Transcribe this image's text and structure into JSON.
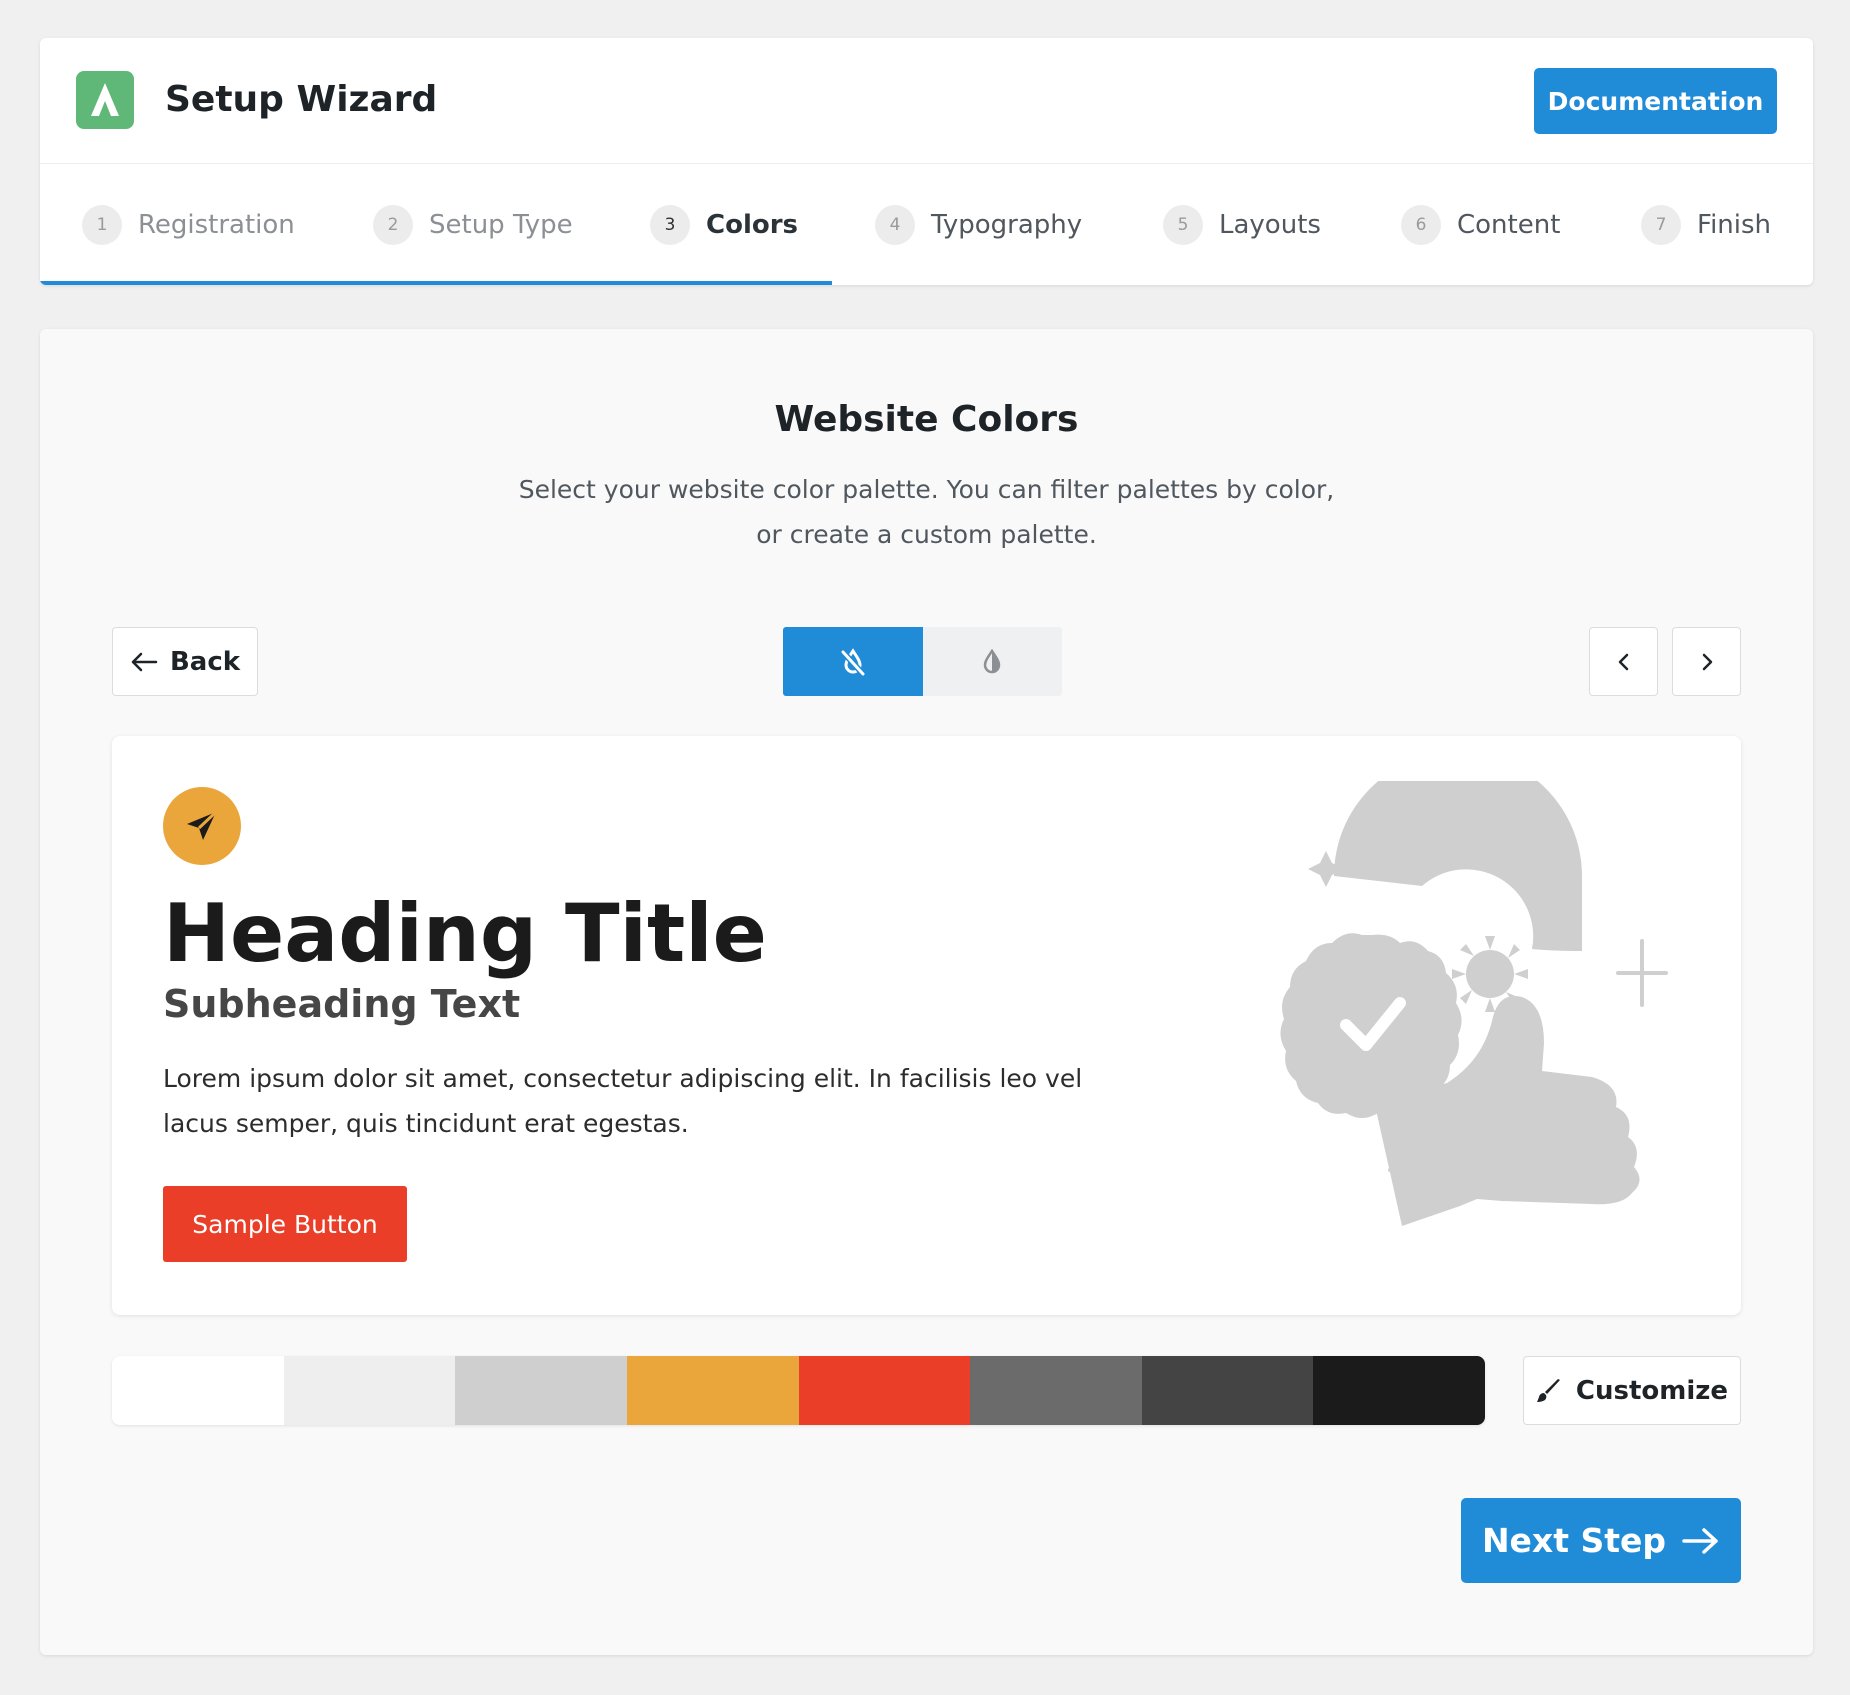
{
  "header": {
    "title": "Setup Wizard",
    "logo_icon": "wizard-logo-icon",
    "documentation_label": "Documentation"
  },
  "steps": [
    {
      "num": "1",
      "label": "Registration",
      "state": "done"
    },
    {
      "num": "2",
      "label": "Setup Type",
      "state": "done"
    },
    {
      "num": "3",
      "label": "Colors",
      "state": "current"
    },
    {
      "num": "4",
      "label": "Typography",
      "state": "upcoming"
    },
    {
      "num": "5",
      "label": "Layouts",
      "state": "upcoming"
    },
    {
      "num": "6",
      "label": "Content",
      "state": "upcoming"
    },
    {
      "num": "7",
      "label": "Finish",
      "state": "upcoming"
    }
  ],
  "main": {
    "title": "Website Colors",
    "description": "Select your website color palette. You can filter palettes by color, or create a custom palette.",
    "back_label": "Back",
    "toggle": {
      "options": [
        {
          "icon": "color-filter-off-icon",
          "active": true
        },
        {
          "icon": "contrast-drop-icon",
          "active": false
        }
      ]
    },
    "prev_icon": "chevron-left-icon",
    "next_icon": "chevron-right-icon"
  },
  "preview": {
    "icon": "paper-plane-icon",
    "heading": "Heading Title",
    "subheading": "Subheading Text",
    "body": "Lorem ipsum dolor sit amet, consectetur adipiscing elit. In facilisis leo vel lacus semper, quis tincidunt erat egestas.",
    "button_label": "Sample Button",
    "illustration": "badge-thumbs-up-illustration"
  },
  "palette": {
    "colors": [
      "#ffffff",
      "#eeeeee",
      "#cfcfcf",
      "#eba63b",
      "#eb3e28",
      "#6b6b6b",
      "#444444",
      "#1b1b1b"
    ],
    "customize_label": "Customize",
    "customize_icon": "brush-icon"
  },
  "footer": {
    "next_label": "Next Step",
    "next_icon": "arrow-right-icon"
  },
  "colors": {
    "accent": "#208bd7",
    "logo": "#5fb877",
    "preview_accent": "#eba63b",
    "preview_button": "#eb3e28"
  }
}
